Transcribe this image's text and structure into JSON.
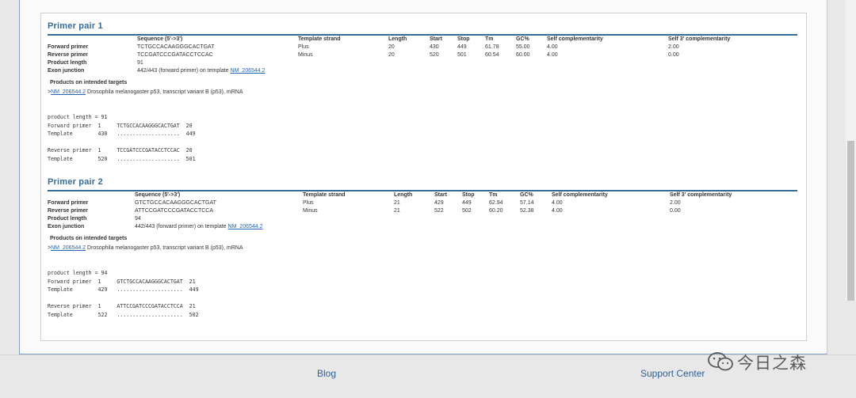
{
  "pairs": [
    {
      "title": "Primer pair 1",
      "headers": [
        "Sequence (5'->3')",
        "Template strand",
        "Length",
        "Start",
        "Stop",
        "Tm",
        "GC%",
        "Self complementarity",
        "Self 3' complementarity"
      ],
      "forward": {
        "label": "Forward primer",
        "seq": "TCTGCCACAAGGGCACTGAT",
        "strand": "Plus",
        "length": "20",
        "start": "430",
        "stop": "449",
        "tm": "61.78",
        "gc": "55.00",
        "self": "4.00",
        "self3": "2.00"
      },
      "reverse": {
        "label": "Reverse primer",
        "seq": "TCCGATCCCGATACCTCCAC",
        "strand": "Minus",
        "length": "20",
        "start": "520",
        "stop": "501",
        "tm": "60.54",
        "gc": "60.00",
        "self": "4.00",
        "self3": "0.00"
      },
      "product_length_label": "Product length",
      "product_length": "91",
      "exon_label": "Exon junction",
      "exon_text": "442/443 (forward primer) on template",
      "exon_link": "NM_206544.2",
      "products_heading": "Products on intended targets",
      "target_prefix": ">",
      "target_link": "NM_206544.2",
      "target_desc": " Drosophila melanogaster p53, transcript variant B (p53), mRNA",
      "alignment": "product length = 91\nForward primer  1     TCTGCCACAAGGGCACTGAT  20\nTemplate        430   ....................  449\n\nReverse primer  1     TCCGATCCCGATACCTCCAC  20\nTemplate        520   ....................  501"
    },
    {
      "title": "Primer pair 2",
      "headers": [
        "Sequence (5'->3')",
        "Template strand",
        "Length",
        "Start",
        "Stop",
        "Tm",
        "GC%",
        "Self complementarity",
        "Self 3' complementarity"
      ],
      "forward": {
        "label": "Forward primer",
        "seq": "GTCTGCCACAAGGGCACTGAT",
        "strand": "Plus",
        "length": "21",
        "start": "429",
        "stop": "449",
        "tm": "62.94",
        "gc": "57.14",
        "self": "4.00",
        "self3": "2.00"
      },
      "reverse": {
        "label": "Reverse primer",
        "seq": "ATTCCGATCCCGATACCTCCA",
        "strand": "Minus",
        "length": "21",
        "start": "522",
        "stop": "502",
        "tm": "60.20",
        "gc": "52.38",
        "self": "4.00",
        "self3": "0.00"
      },
      "product_length_label": "Product length",
      "product_length": "94",
      "exon_label": "Exon junction",
      "exon_text": "442/443 (forward primer) on template",
      "exon_link": "NM_206544.2",
      "products_heading": "Products on intended targets",
      "target_prefix": ">",
      "target_link": "NM_206544.2",
      "target_desc": " Drosophila melanogaster p53, transcript variant B (p53), mRNA",
      "alignment": "product length = 94\nForward primer  1     GTCTGCCACAAGGGCACTGAT  21\nTemplate        429   .....................  449\n\nReverse primer  1     ATTCCGATCCCGATACCTCCA  21\nTemplate        522   .....................  502"
    }
  ],
  "footer": {
    "blog": "Blog",
    "support": "Support Center"
  },
  "watermark": "今日之森",
  "colors": {
    "accent": "#336c99",
    "link": "#2563b5"
  }
}
